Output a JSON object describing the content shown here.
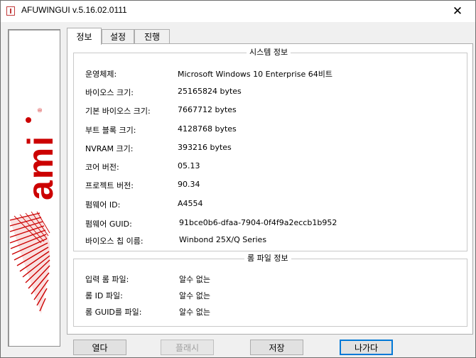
{
  "window": {
    "title": "AFUWINGUI v.5.16.02.0111",
    "close_glyph": "✕"
  },
  "logo": {
    "text": "ami",
    "registered": "®",
    "brand_color": "#cc0000"
  },
  "tabs": [
    {
      "label": "정보",
      "active": true
    },
    {
      "label": "설정",
      "active": false
    },
    {
      "label": "진행",
      "active": false
    }
  ],
  "system_info": {
    "title": "시스템 정보",
    "rows": [
      {
        "label": "운영체제:",
        "value": "Microsoft Windows 10 Enterprise 64비트"
      },
      {
        "label": "바이오스 크기:",
        "value": "25165824 bytes"
      },
      {
        "label": "기본 바이오스 크기:",
        "value": "7667712 bytes"
      },
      {
        "label": "부트 블록 크기:",
        "value": "4128768 bytes"
      },
      {
        "label": "NVRAM 크기:",
        "value": "393216 bytes"
      },
      {
        "label": "코어 버전:",
        "value": "05.13"
      },
      {
        "label": "프로젝트 버전:",
        "value": "90.34"
      },
      {
        "label": "펌웨어 ID:",
        "value": "A4554"
      },
      {
        "label": "펌웨어 GUID:",
        "value": "91bce0b6-dfaa-7904-0f4f9a2eccb1b952"
      },
      {
        "label": "바이오스 칩 이름:",
        "value": "Winbond 25X/Q Series"
      }
    ]
  },
  "rom_info": {
    "title": "롬 파일 정보",
    "rows": [
      {
        "label": "입력 롬 파일:",
        "value": "알수 없는"
      },
      {
        "label": "롬 ID 파일:",
        "value": "알수 없는"
      },
      {
        "label": "롬 GUID를 파일:",
        "value": "알수 없는"
      }
    ]
  },
  "buttons": {
    "open": "열다",
    "flash": "플래시",
    "save": "저장",
    "exit": "나가다"
  }
}
